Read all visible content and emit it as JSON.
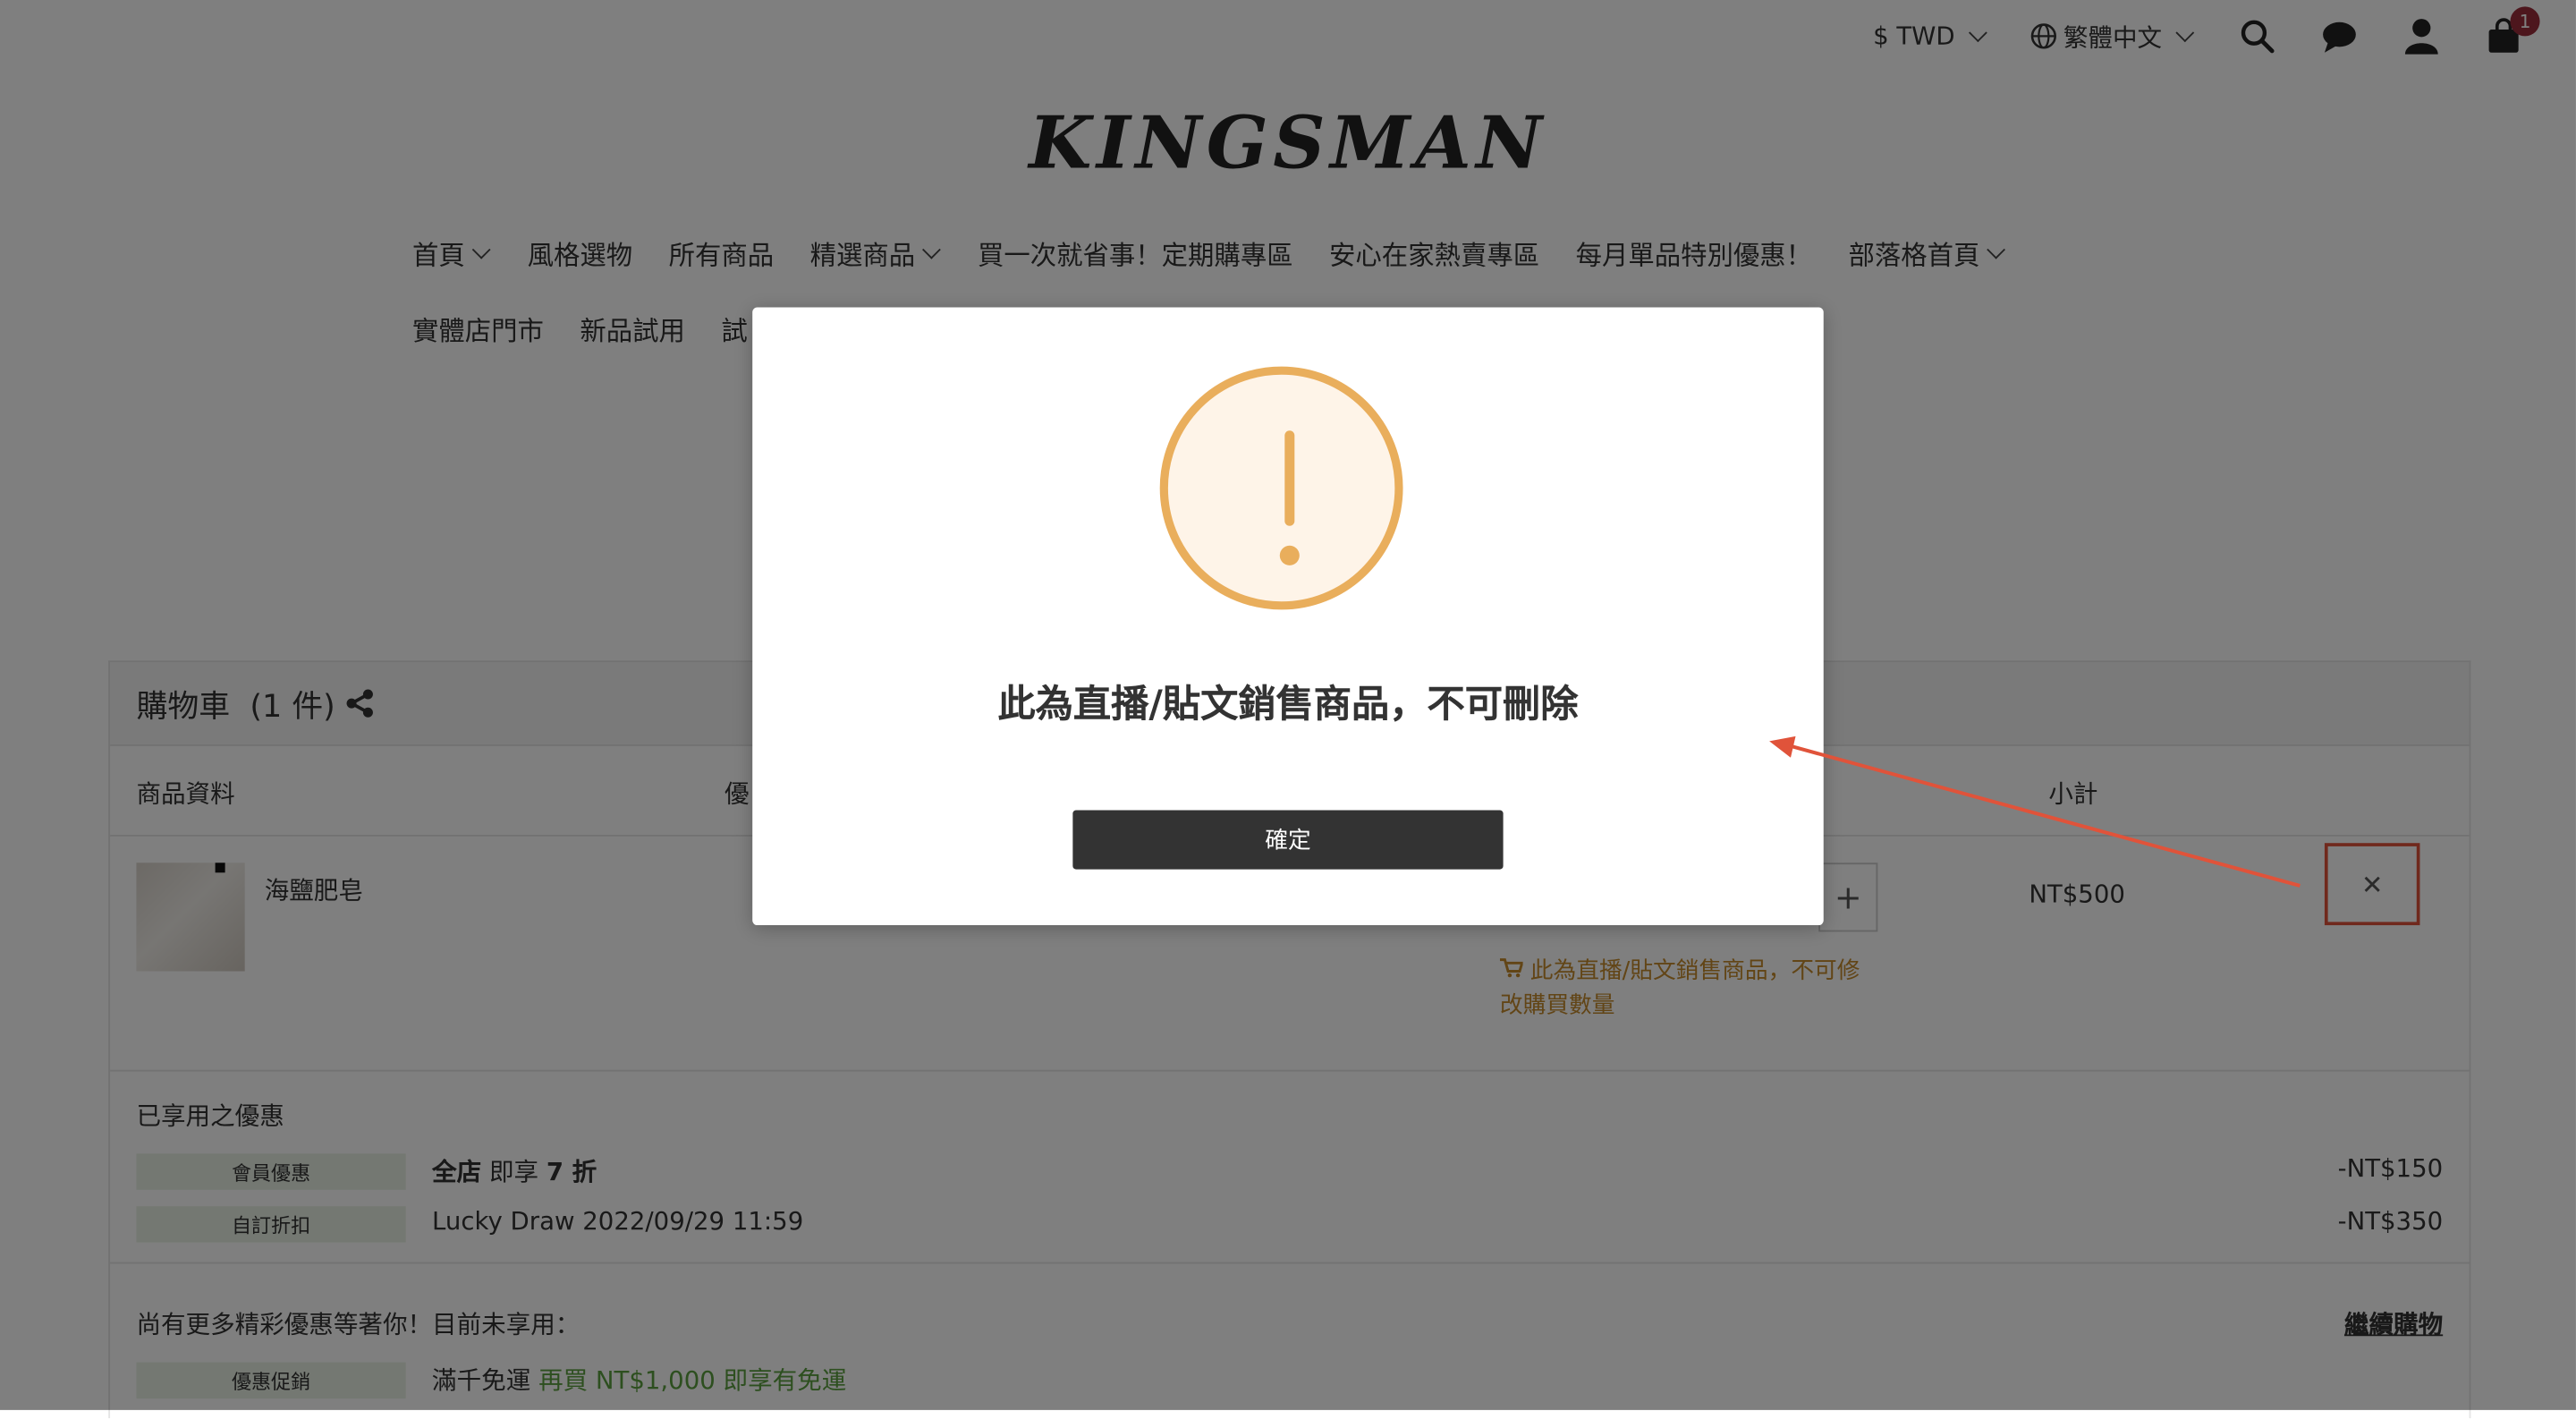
{
  "topbar": {
    "currency": "$ TWD",
    "language": "繁體中文",
    "cart_count": "1",
    "icons": [
      "search-icon",
      "chat-icon",
      "user-icon",
      "cart-icon"
    ]
  },
  "logo": "KINGSMAN",
  "nav": {
    "row1": [
      "首頁",
      "風格選物",
      "所有商品",
      "精選商品",
      "買一次就省事！定期購專區",
      "安心在家熱賣專區",
      "每月單品特別優惠！",
      "部落格首頁"
    ],
    "row2": [
      "實體店門市",
      "新品試用",
      "試"
    ]
  },
  "cart": {
    "title": "購物車",
    "count": "(1 件)",
    "columns": {
      "product": "商品資料",
      "discount": "優",
      "subtotal": "小計"
    },
    "item": {
      "name": "海鹽肥皂",
      "qty_plus": "+",
      "price": "NT$500",
      "note": "此為直播/貼文銷售商品，不可修改購買數量",
      "delete": "✕"
    },
    "applied": {
      "title": "已享用之優惠",
      "rows": [
        {
          "tag": "會員優惠",
          "desc_bold": "全店",
          "desc": " 即享 ",
          "desc_bold2": "7 折",
          "amount": "-NT$150"
        },
        {
          "tag": "自訂折扣",
          "desc": "Lucky Draw 2022/09/29 11:59",
          "amount": "-NT$350"
        }
      ]
    },
    "more": {
      "title": "尚有更多精彩優惠等著你！目前未享用：",
      "continue": "繼續購物",
      "tag": "優惠促銷",
      "desc": "滿千免運",
      "desc_green": "再買 NT$1,000 即享有免運"
    }
  },
  "modal": {
    "message": "此為直播/貼文銷售商品，不可刪除",
    "confirm": "確定"
  },
  "colors": {
    "warning": "#e9ae5c",
    "annotation": "#e0533a",
    "badge": "#9b2d3a"
  }
}
